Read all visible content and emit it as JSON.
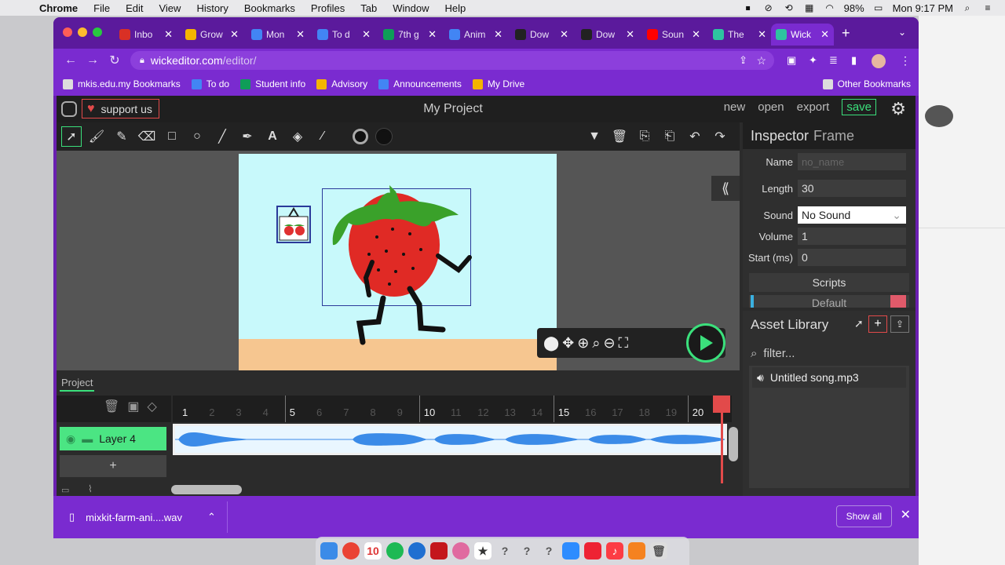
{
  "menubar": {
    "app": "Chrome",
    "items": [
      "File",
      "Edit",
      "View",
      "History",
      "Bookmarks",
      "Profiles",
      "Tab",
      "Window",
      "Help"
    ],
    "battery": "98%",
    "clock": "Mon 9:17 PM"
  },
  "tabs": [
    {
      "label": "Inbo",
      "color": "#d93025"
    },
    {
      "label": "Grow",
      "color": "#f4b400"
    },
    {
      "label": "Mon",
      "color": "#4285f4"
    },
    {
      "label": "To d",
      "color": "#4285f4"
    },
    {
      "label": "7th g",
      "color": "#0f9d58"
    },
    {
      "label": "Anim",
      "color": "#4285f4"
    },
    {
      "label": "Dow",
      "color": "#222222"
    },
    {
      "label": "Dow",
      "color": "#222222"
    },
    {
      "label": "Soun",
      "color": "#ff0000"
    },
    {
      "label": "The",
      "color": "#2ec4a0"
    },
    {
      "label": "Wick",
      "color": "#2ec4a0"
    }
  ],
  "address": {
    "host": "wickeditor.com",
    "path": "/editor/"
  },
  "bookmarks": [
    {
      "label": "mkis.edu.my Bookmarks",
      "color": "#cccccc"
    },
    {
      "label": "To do",
      "color": "#4285f4"
    },
    {
      "label": "Student info",
      "color": "#0f9d58"
    },
    {
      "label": "Advisory",
      "color": "#f4b400"
    },
    {
      "label": "Announcements",
      "color": "#4285f4"
    },
    {
      "label": "My Drive",
      "color": "#f4b400"
    }
  ],
  "other_bookmarks": "Other Bookmarks",
  "editor": {
    "support_label": "support us",
    "project_title": "My Project",
    "actions": {
      "new": "new",
      "open": "open",
      "export": "export",
      "save": "save"
    }
  },
  "inspector": {
    "title": "Inspector",
    "subtitle": "Frame",
    "name_label": "Name",
    "name_placeholder": "no_name",
    "length_label": "Length",
    "length_value": "30",
    "sound_label": "Sound",
    "sound_value": "No Sound",
    "volume_label": "Volume",
    "volume_value": "1",
    "start_label": "Start (ms)",
    "start_value": "0",
    "scripts_label": "Scripts",
    "script_default": "Default"
  },
  "assets": {
    "title": "Asset Library",
    "filter_placeholder": "filter...",
    "items": [
      "Untitled song.mp3"
    ]
  },
  "timeline": {
    "tab": "Project",
    "layer_name": "Layer 4",
    "frame_numbers": [
      "1",
      "2",
      "3",
      "4",
      "5",
      "6",
      "7",
      "8",
      "9",
      "10",
      "11",
      "12",
      "13",
      "14",
      "15",
      "16",
      "17",
      "18",
      "19",
      "20"
    ]
  },
  "download": {
    "filename": "mixkit-farm-ani....wav",
    "show_all": "Show all"
  },
  "colors": {
    "chrome_purple": "#7a2bd0",
    "wick_green": "#3be07c",
    "stage_bg": "#c8f9fb",
    "layer_green": "#4be583"
  }
}
